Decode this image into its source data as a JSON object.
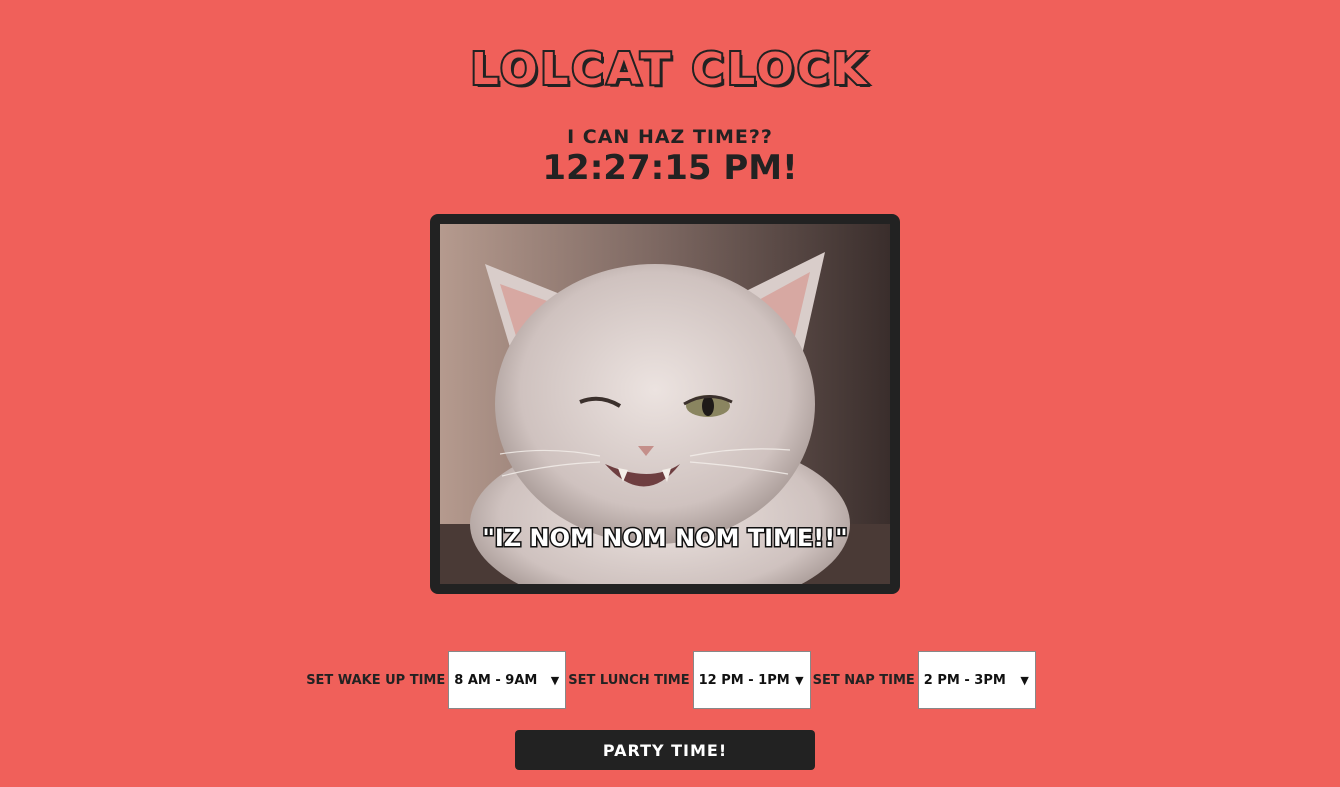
{
  "header": {
    "title": "LOLCAT CLOCK",
    "subtitle": "I CAN HAZ TIME??",
    "clock": "12:27:15 PM!"
  },
  "photo": {
    "caption": "\"IZ NOM NOM NOM TIME!!\""
  },
  "controls": {
    "wake_label": "SET WAKE UP TIME",
    "wake_value": "8 AM - 9AM",
    "lunch_label": "SET LUNCH TIME",
    "lunch_value": "12 PM - 1PM",
    "nap_label": "SET NAP TIME",
    "nap_value": "2 PM - 3PM",
    "party_button": "PARTY TIME!"
  },
  "icons": {
    "dropdown": "chevron-down-icon"
  },
  "colors": {
    "background": "#f0605a",
    "ink": "#222222",
    "button_text": "#ffffff"
  }
}
